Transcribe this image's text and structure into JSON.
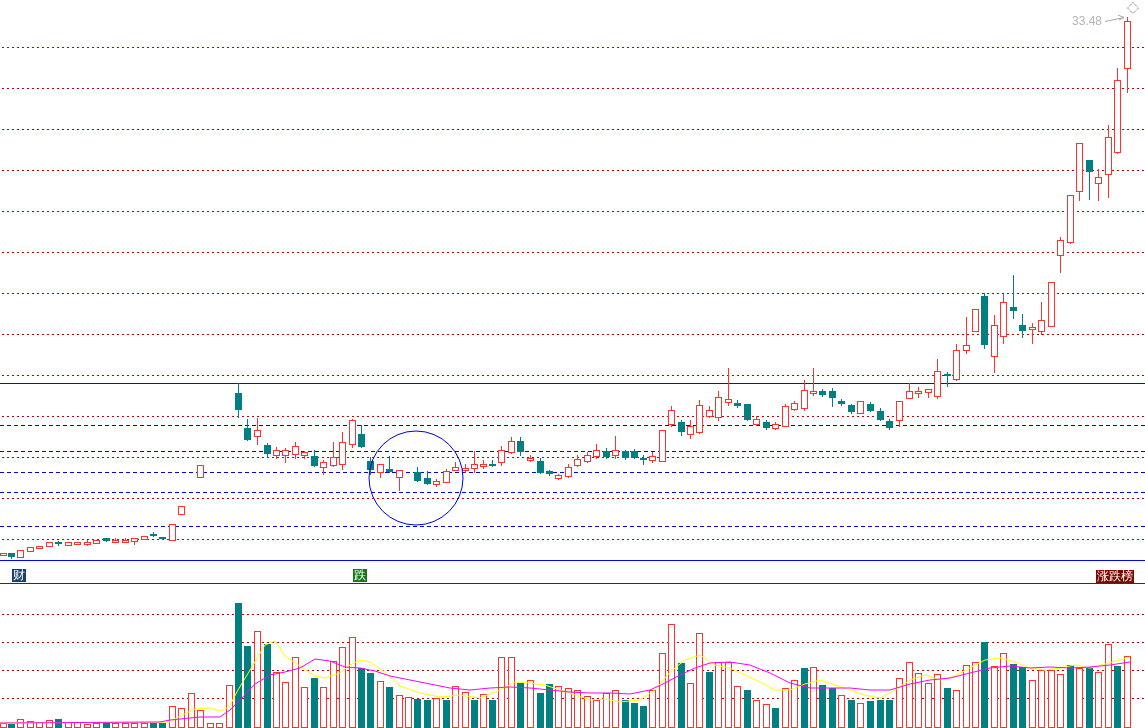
{
  "price_panel": {
    "max_price_label": "33.48"
  },
  "event_markers": [
    {
      "text": "财",
      "color": "#1c3f6e"
    },
    {
      "text": "跌",
      "color": "#107a10"
    },
    {
      "text": "涨跌榜",
      "color": "#7a0a00"
    }
  ]
}
